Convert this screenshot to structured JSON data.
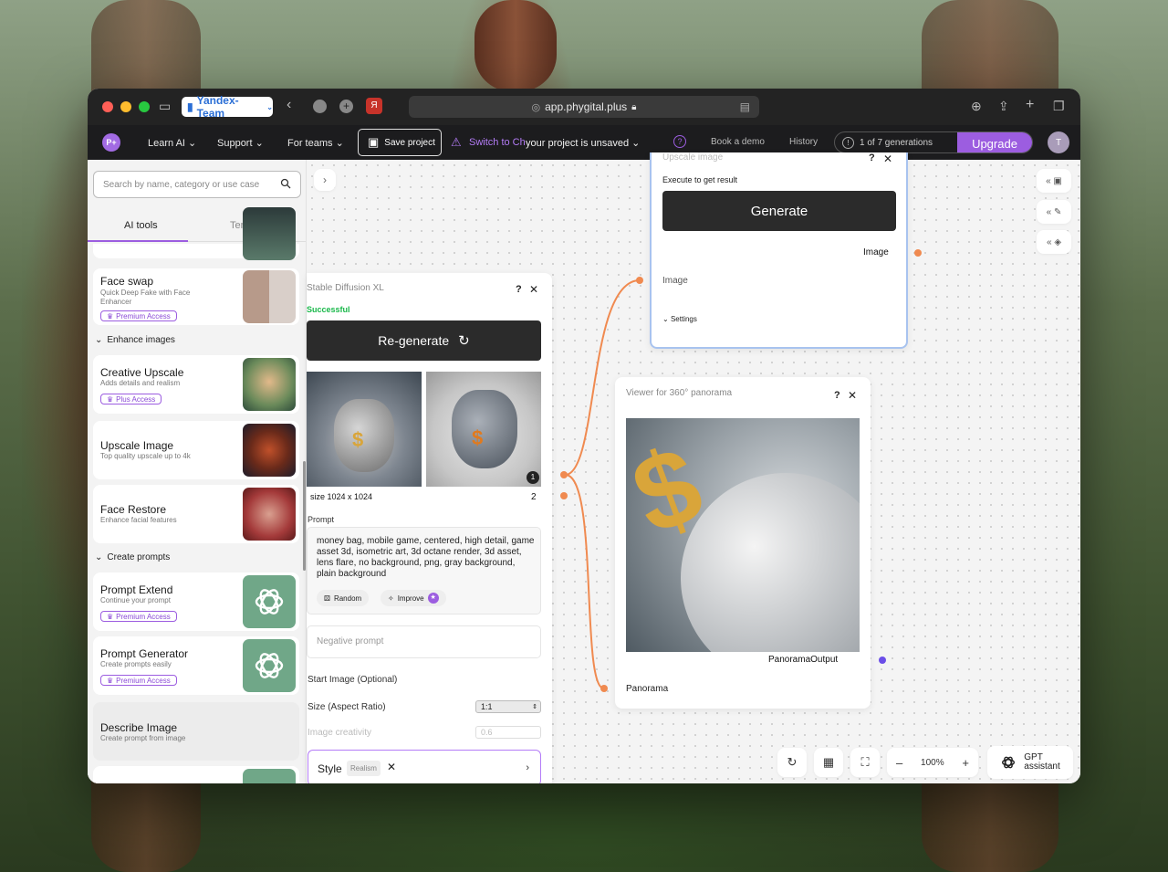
{
  "browser": {
    "profile": "Yandex-Team",
    "url": "app.phygital.plus"
  },
  "appbar": {
    "logo": "P+",
    "learn_ai": "Learn AI",
    "support": "Support",
    "for_teams": "For teams",
    "save_project": "Save project",
    "switch_text": "Switch to Ch",
    "unsaved_text": "your project is unsaved",
    "book_demo": "Book a demo",
    "history": "History",
    "generations": "1 of 7 generations",
    "upgrade": "Upgrade",
    "avatar": "T"
  },
  "sidebar": {
    "search_placeholder": "Search by name, category or use case",
    "tab_ai_tools": "AI tools",
    "tab_templates": "Templates",
    "face_swap": {
      "title": "Face swap",
      "subtitle": "Quick Deep Fake with Face Enhancer",
      "badge": "Premium Access"
    },
    "section_enhance": "Enhance images",
    "creative_upscale": {
      "title": "Creative Upscale",
      "subtitle": "Adds details and realism",
      "badge": "Plus Access"
    },
    "upscale_image": {
      "title": "Upscale Image",
      "subtitle": "Top quality upscale up to 4k"
    },
    "face_restore": {
      "title": "Face Restore",
      "subtitle": "Enhance facial features"
    },
    "section_prompts": "Create prompts",
    "prompt_extend": {
      "title": "Prompt Extend",
      "subtitle": "Continue your prompt",
      "badge": "Premium Access"
    },
    "prompt_generator": {
      "title": "Prompt Generator",
      "subtitle": "Create prompts easily",
      "badge": "Premium Access"
    },
    "describe_image": {
      "title": "Describe Image",
      "subtitle": "Create prompt from image"
    }
  },
  "sd_panel": {
    "title": "Stable Diffusion XL",
    "status": "Successful",
    "regenerate": "Re-generate",
    "size_label": "size 1024 x 1024",
    "count": "2",
    "image_badge": "1",
    "prompt_label": "Prompt",
    "prompt_text": "money bag, mobile game, centered, high detail, game asset 3d, isometric art, 3d octane render, 3d asset, lens flare, no background, png, gray background, plain background",
    "random": "Random",
    "improve": "Improve",
    "negative_placeholder": "Negative prompt",
    "start_image": "Start Image (Optional)",
    "size_aspect": "Size (Aspect Ratio)",
    "aspect_value": "1:1",
    "creativity_label": "Image creativity",
    "creativity_value": "0.6",
    "style_label": "Style",
    "style_tag": "Realism"
  },
  "upscale_panel": {
    "title": "Upscale image",
    "execute": "Execute to get result",
    "generate": "Generate",
    "output_image": "Image",
    "input_image": "Image",
    "settings": "Settings"
  },
  "viewer_panel": {
    "title": "Viewer for 360° panorama",
    "output_label": "PanoramaOutput",
    "input_label": "Panorama"
  },
  "toolbar": {
    "zoom": "100%",
    "gpt_line1": "GPT",
    "gpt_line2": "assistant"
  },
  "colors": {
    "accent": "#9c5de0",
    "port_orange": "#f08a50",
    "port_purple": "#6b4ee8",
    "success": "#19b84a"
  }
}
